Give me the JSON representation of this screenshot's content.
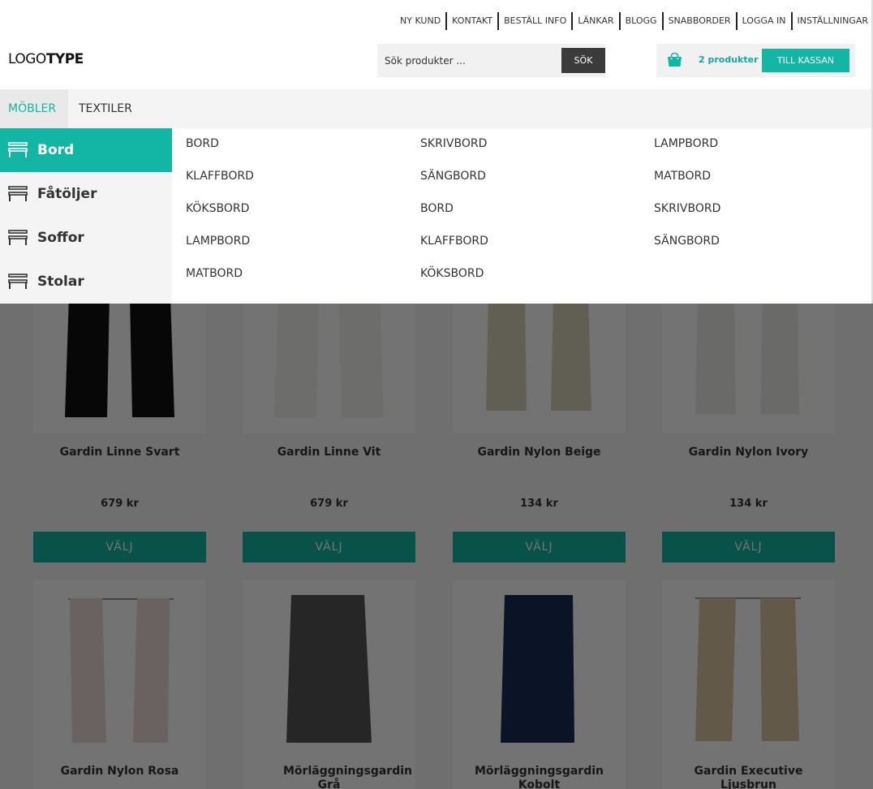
{
  "toplinks": [
    "NY KUND",
    "KONTAKT",
    "BESTÄLL INFO",
    "LÄNKAR",
    "BLOGG",
    "SNABBORDER",
    "LOGGA IN",
    "INSTÄLLNINGAR"
  ],
  "logo": {
    "part1": "LOGO",
    "part2": "TYPE"
  },
  "search": {
    "placeholder": "Sök produkter ...",
    "button": "SÖK"
  },
  "cart": {
    "count_label": "2 produkter",
    "checkout_label": "TILL KASSAN",
    "icon": "shopping-bag-icon"
  },
  "nav": {
    "tabs": [
      "MÖBLER",
      "TEXTILER"
    ],
    "active": "MÖBLER"
  },
  "categories": [
    {
      "label": "Bord",
      "icon": "bench-icon",
      "active": true
    },
    {
      "label": "Fåtöljer",
      "icon": "bench-icon",
      "active": false
    },
    {
      "label": "Soffor",
      "icon": "bench-icon",
      "active": false
    },
    {
      "label": "Stolar",
      "icon": "bench-icon",
      "active": false
    }
  ],
  "submenu": {
    "col1": [
      "BORD",
      "KLAFFBORD",
      "KÖKSBORD",
      "LAMPBORD",
      "MATBORD"
    ],
    "col2": [
      "SKRIVBORD",
      "SÄNGBORD",
      "BORD",
      "KLAFFBORD",
      "KÖKSBORD"
    ],
    "col3": [
      "LAMPBORD",
      "MATBORD",
      "SKRIVBORD",
      "SÄNGBORD"
    ]
  },
  "products": [
    {
      "name": "Gardin Linne Svart",
      "price": "679 kr",
      "button": "VÄLJ",
      "color": "#111111"
    },
    {
      "name": "Gardin Linne Vit",
      "price": "679 kr",
      "button": "VÄLJ",
      "color": "#f2f2f0"
    },
    {
      "name": "Gardin Nylon Beige",
      "price": "134 kr",
      "button": "VÄLJ",
      "color": "#d8d1b8"
    },
    {
      "name": "Gardin Nylon Ivory",
      "price": "134 kr",
      "button": "VÄLJ",
      "color": "#ecebe7"
    },
    {
      "name": "Gardin Nylon Rosa",
      "price": "",
      "button": "",
      "color": "#e8d9d5"
    },
    {
      "name": "Mörläggningsgardin Grå",
      "price": "",
      "button": "",
      "color": "#555555"
    },
    {
      "name": "Mörläggningsgardin Kobolt",
      "price": "",
      "button": "",
      "color": "#1a2a55"
    },
    {
      "name": "Gardin Executive Ljusbrun",
      "price": "",
      "button": "",
      "color": "#d9c6a3"
    }
  ],
  "colors": {
    "accent": "#13b5a4",
    "overlay": "rgba(0,0,0,0.55)"
  }
}
